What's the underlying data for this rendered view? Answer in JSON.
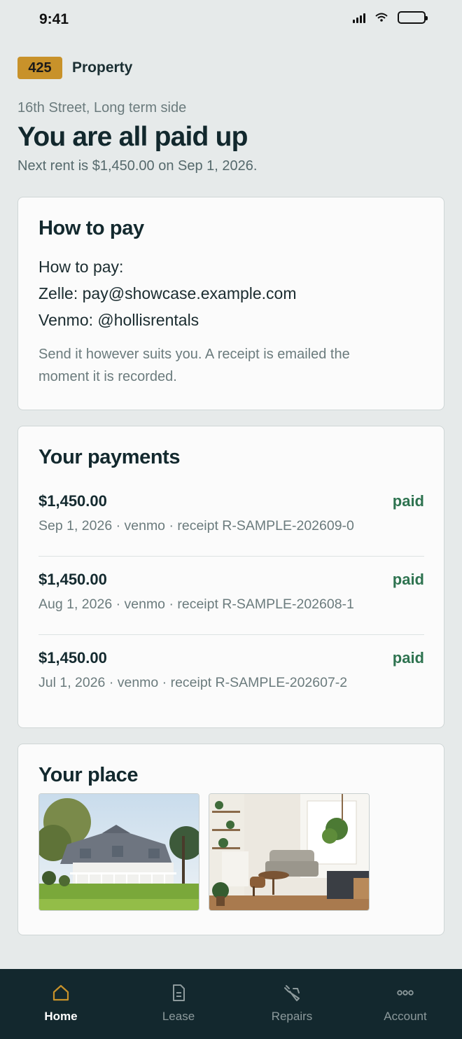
{
  "status_bar": {
    "time": "9:41"
  },
  "property": {
    "number": "425",
    "label": "Property"
  },
  "header": {
    "subtitle": "16th Street, Long term side",
    "headline": "You are all paid up",
    "next_rent": "Next rent is $1,450.00 on Sep 1, 2026."
  },
  "how_to_pay": {
    "title": "How to pay",
    "lines": [
      "How to pay:",
      "Zelle: pay@showcase.example.com",
      "Venmo: @hollisrentals"
    ],
    "note": "Send it however suits you. A receipt is emailed the moment it is recorded."
  },
  "payments": {
    "title": "Your payments",
    "items": [
      {
        "amount": "$1,450.00",
        "meta": "Sep 1, 2026 · venmo · receipt R-SAMPLE-202609-0",
        "status": "paid"
      },
      {
        "amount": "$1,450.00",
        "meta": "Aug 1, 2026 · venmo · receipt R-SAMPLE-202608-1",
        "status": "paid"
      },
      {
        "amount": "$1,450.00",
        "meta": "Jul 1, 2026 · venmo · receipt R-SAMPLE-202607-2",
        "status": "paid"
      }
    ]
  },
  "place": {
    "title": "Your place"
  },
  "tabs": [
    {
      "label": "Home",
      "icon": "home-icon",
      "active": true
    },
    {
      "label": "Lease",
      "icon": "document-icon",
      "active": false
    },
    {
      "label": "Repairs",
      "icon": "wrench-icon",
      "active": false
    },
    {
      "label": "Account",
      "icon": "more-icon",
      "active": false
    }
  ],
  "colors": {
    "accent": "#c8922a",
    "paid": "#2e7350",
    "tabbar": "#13282e",
    "background": "#e6eaea"
  }
}
